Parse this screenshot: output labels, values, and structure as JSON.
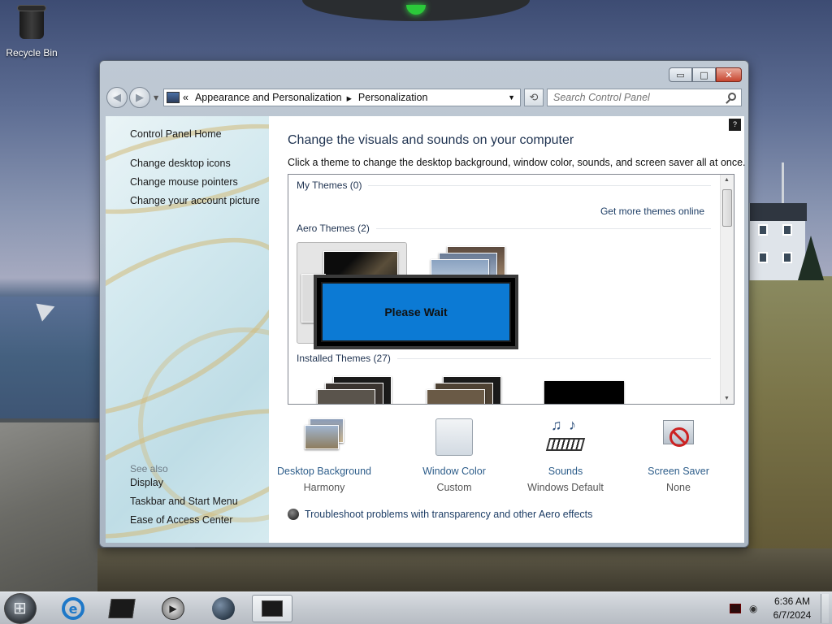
{
  "desktop": {
    "icons": [
      {
        "label": "Recycle Bin",
        "icon": "recycle-bin-icon"
      }
    ]
  },
  "window": {
    "caption_buttons": {
      "minimize": "▭",
      "maximize": "□",
      "close": "✕"
    },
    "navigation": {
      "back": "◀",
      "forward": "▶",
      "address_prefix": "«",
      "breadcrumb": [
        "Appearance and Personalization",
        "Personalization"
      ],
      "breadcrumb_separator": "▸",
      "refresh": "⟲",
      "search_placeholder": "Search Control Panel"
    },
    "left_pane": {
      "home_link": "Control Panel Home",
      "tasks": [
        "Change desktop icons",
        "Change mouse pointers",
        "Change your account picture"
      ],
      "see_also_heading": "See also",
      "see_also_links": [
        "Display",
        "Taskbar and Start Menu",
        "Ease of Access Center"
      ]
    },
    "content": {
      "help": "?",
      "title": "Change the visuals and sounds on your computer",
      "description": "Click a theme to change the desktop background, window color, sounds, and screen saver all at once.",
      "groups": {
        "my_themes": "My Themes (0)",
        "get_more": "Get more themes online",
        "aero_themes": "Aero Themes (2)",
        "installed_themes": "Installed Themes (27)"
      },
      "overlay_text": "Please Wait",
      "bottom_items": [
        {
          "name": "Desktop Background",
          "value": "Harmony",
          "icon": "desktop-background-icon"
        },
        {
          "name": "Window Color",
          "value": "Custom",
          "icon": "window-color-icon"
        },
        {
          "name": "Sounds",
          "value": "Windows Default",
          "icon": "sounds-icon"
        },
        {
          "name": "Screen Saver",
          "value": "None",
          "icon": "screen-saver-icon"
        }
      ],
      "troubleshoot_link": "Troubleshoot problems with transparency and other Aero effects"
    }
  },
  "taskbar": {
    "items": [
      "start-button",
      "internet-explorer-icon",
      "media-center-icon",
      "media-player-icon",
      "globe-icon",
      "control-panel-icon"
    ],
    "clock": {
      "time": "6:36 AM",
      "date": "6/7/2024"
    },
    "colors": {
      "overlay_blue": "#0c7ad4",
      "link_blue": "#2d5d8a"
    }
  }
}
